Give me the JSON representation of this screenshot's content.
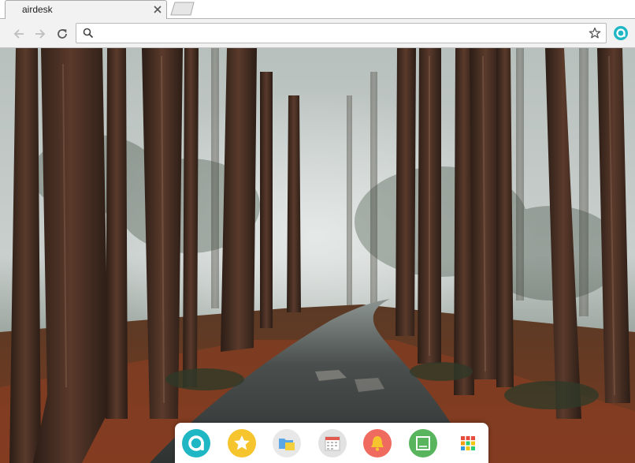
{
  "browser": {
    "tab": {
      "title": "airdesk",
      "close_icon": "close-icon"
    },
    "new_tab_icon": "new-tab-icon",
    "toolbar": {
      "back_icon": "arrow-left-icon",
      "forward_icon": "arrow-right-icon",
      "reload_icon": "reload-icon",
      "omnibox": {
        "value": "",
        "placeholder": "",
        "search_icon": "search-icon",
        "bookmark_icon": "star-outline-icon"
      },
      "extension_icon": "airdesk-extension-icon"
    }
  },
  "wallpaper": {
    "description_icon": "forest-road-wallpaper",
    "colors": {
      "fog": "#c9cfcd",
      "trunk": "#4a3326",
      "ground": "#8a3e22",
      "road": "#3c403f"
    }
  },
  "dock": {
    "items": [
      {
        "icon": "airdesk-logo-icon",
        "color": "#1fb7c4"
      },
      {
        "icon": "star-icon",
        "color": "#f6c42d"
      },
      {
        "icon": "folder-notes-icon",
        "color": "#e8e8e8"
      },
      {
        "icon": "calendar-icon",
        "color": "#e2e2e2"
      },
      {
        "icon": "bell-icon",
        "color": "#ef6b5f"
      },
      {
        "icon": "note-icon",
        "color": "#58b55d"
      },
      {
        "icon": "apps-grid-icon",
        "color": "#ffffff"
      }
    ]
  }
}
